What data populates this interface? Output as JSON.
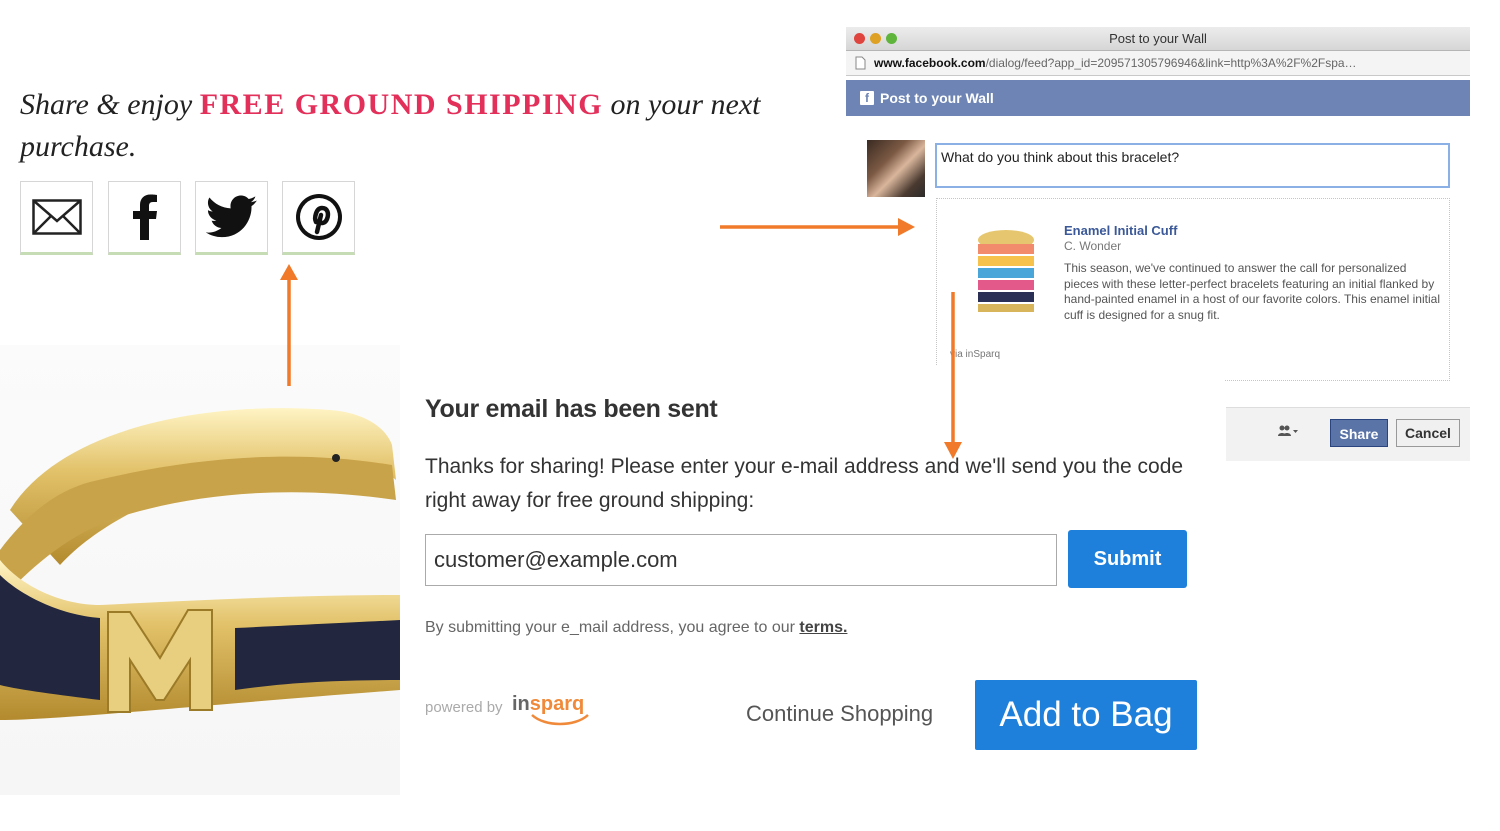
{
  "share": {
    "prefix": "Share & enjoy ",
    "highlight": "FREE GROUND SHIPPING",
    "suffix": " on your next purchase.",
    "highlight_color": "#e2305b",
    "buttons": [
      {
        "label": "Email",
        "icon": "envelope-icon"
      },
      {
        "label": "Facebook",
        "icon": "facebook-icon"
      },
      {
        "label": "Twitter",
        "icon": "twitter-icon"
      },
      {
        "label": "Pinterest",
        "icon": "pinterest-icon"
      }
    ]
  },
  "facebook_dialog": {
    "window_title": "Post to your Wall",
    "url_domain": "www.facebook.com",
    "url_path": "/dialog/feed?app_id=209571305796946&link=http%3A%2F%2Fspa…",
    "header": "Post to your Wall",
    "message": "What do you think about this bracelet?",
    "product": {
      "title": "Enamel Initial Cuff",
      "brand": "C. Wonder",
      "description": "This season, we've continued to answer the call for personalized pieces with these letter-perfect bracelets featuring an initial flanked by hand-painted enamel in a host of our favorite colors. This enamel initial cuff is designed for a snug fit."
    },
    "via": "via inSparq",
    "close_symbol": "×",
    "share_button": "Share",
    "cancel_button": "Cancel",
    "header_color": "#6d84b4"
  },
  "email_modal": {
    "heading": "Your email has been sent",
    "body": "Thanks for sharing! Please enter your e-mail address and we'll send you the code right away for free ground shipping:",
    "email_value": "customer@example.com",
    "submit": "Submit",
    "legal_prefix": "By submitting your e_mail address, you agree to our ",
    "legal_link": "terms.",
    "powered_by": "powered by",
    "brand_a": "in",
    "brand_b": "sparq",
    "continue": "Continue Shopping",
    "add_to_bag": "Add to Bag",
    "button_color": "#1f80dc"
  },
  "arrow_color": "#f07a2a"
}
